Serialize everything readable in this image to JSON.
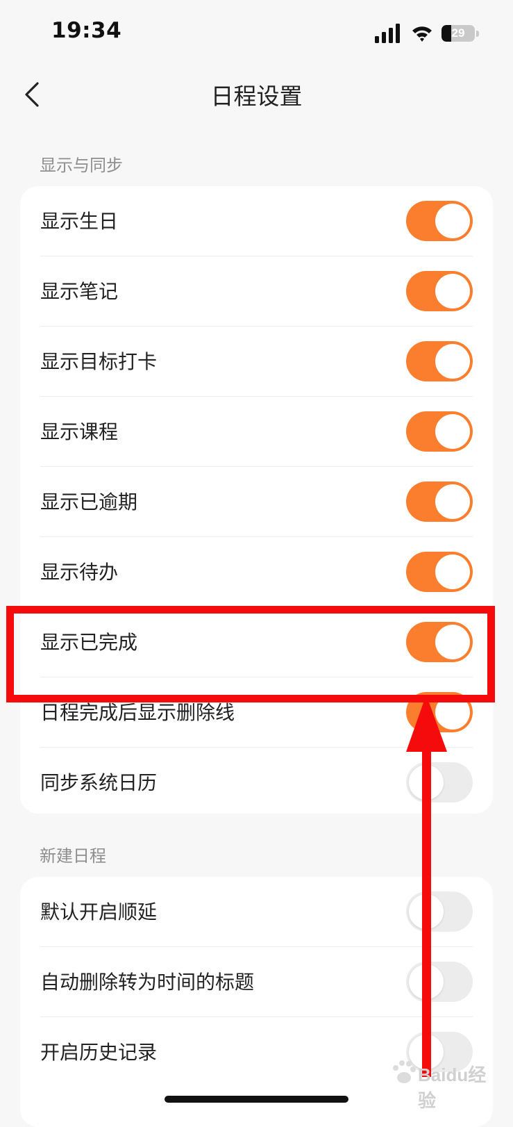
{
  "status_bar": {
    "time": "19:34",
    "battery_level": "29"
  },
  "header": {
    "title": "日程设置"
  },
  "sections": [
    {
      "header": "显示与同步",
      "items": [
        {
          "label": "显示生日",
          "on": true
        },
        {
          "label": "显示笔记",
          "on": true
        },
        {
          "label": "显示目标打卡",
          "on": true
        },
        {
          "label": "显示课程",
          "on": true
        },
        {
          "label": "显示已逾期",
          "on": true
        },
        {
          "label": "显示待办",
          "on": true
        },
        {
          "label": "显示已完成",
          "on": true
        },
        {
          "label": "日程完成后显示删除线",
          "on": true
        },
        {
          "label": "同步系统日历",
          "on": false
        }
      ]
    },
    {
      "header": "新建日程",
      "items": [
        {
          "label": "默认开启顺延",
          "on": false
        },
        {
          "label": "自动删除转为时间的标题",
          "on": false
        },
        {
          "label": "开启历史记录",
          "on": false
        }
      ]
    }
  ],
  "watermark": "Baidu经验",
  "colors": {
    "accent": "#fb7e2f",
    "annotation": "#f50b0b",
    "background": "#f7f7f7"
  }
}
